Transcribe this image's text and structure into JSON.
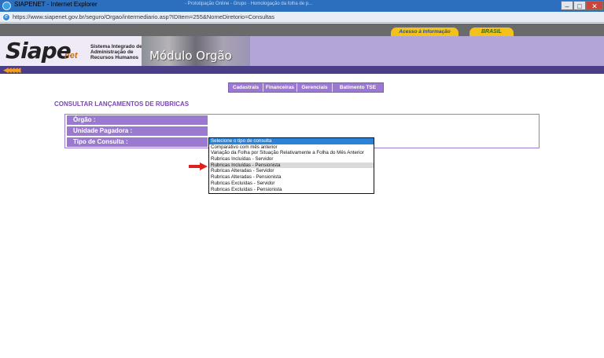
{
  "window": {
    "title": "SIAPENET - Internet Explorer",
    "tabs_ghost": "- Prototipação Online - Grupo  ·  Homologação da folha de p..."
  },
  "browser": {
    "url": "https://www.siapenet.gov.br/seguro/Orgao/intermediario.asp?IDItem=255&NomeDiretorio=Consultas"
  },
  "site": {
    "top_links": [
      "Acesso à Informação",
      "BRASIL"
    ],
    "logo": {
      "main": "Siape",
      "net": "net",
      "subtitle": "Sistema Integrado de Administração de Recursos Humanos"
    },
    "module_title": "Módulo Orgão",
    "stripe_arrows": "◀◀◀◀◀",
    "accent": "#9b79d3",
    "title_color": "#7a45b6"
  },
  "menu": [
    "Cadastrais",
    "Financeiras",
    "Gerenciais",
    "Batimento TSE"
  ],
  "page": {
    "title": "CONSULTAR LANÇAMENTOS DE RUBRICAS",
    "fields": [
      "Órgão :",
      "Unidade Pagadora :",
      "Tipo de Consulta :"
    ]
  },
  "dropdown": {
    "options": [
      "Selecione o tipo de consulta",
      "Comparativo com mês anterior",
      "Variação da Folha por Situação Relativamente a Folha do Mês Anterior",
      "Rubricas Incluídas - Servidor",
      "Rubricas Incluídas - Pensionista",
      "Rubricas Alteradas - Servidor",
      "Rubricas Alteradas - Pensionista",
      "Rubricas Excluídas - Servidor",
      "Rubricas Excluídas - Pensionista"
    ],
    "selected_index": 0,
    "hovered_index": 4
  }
}
